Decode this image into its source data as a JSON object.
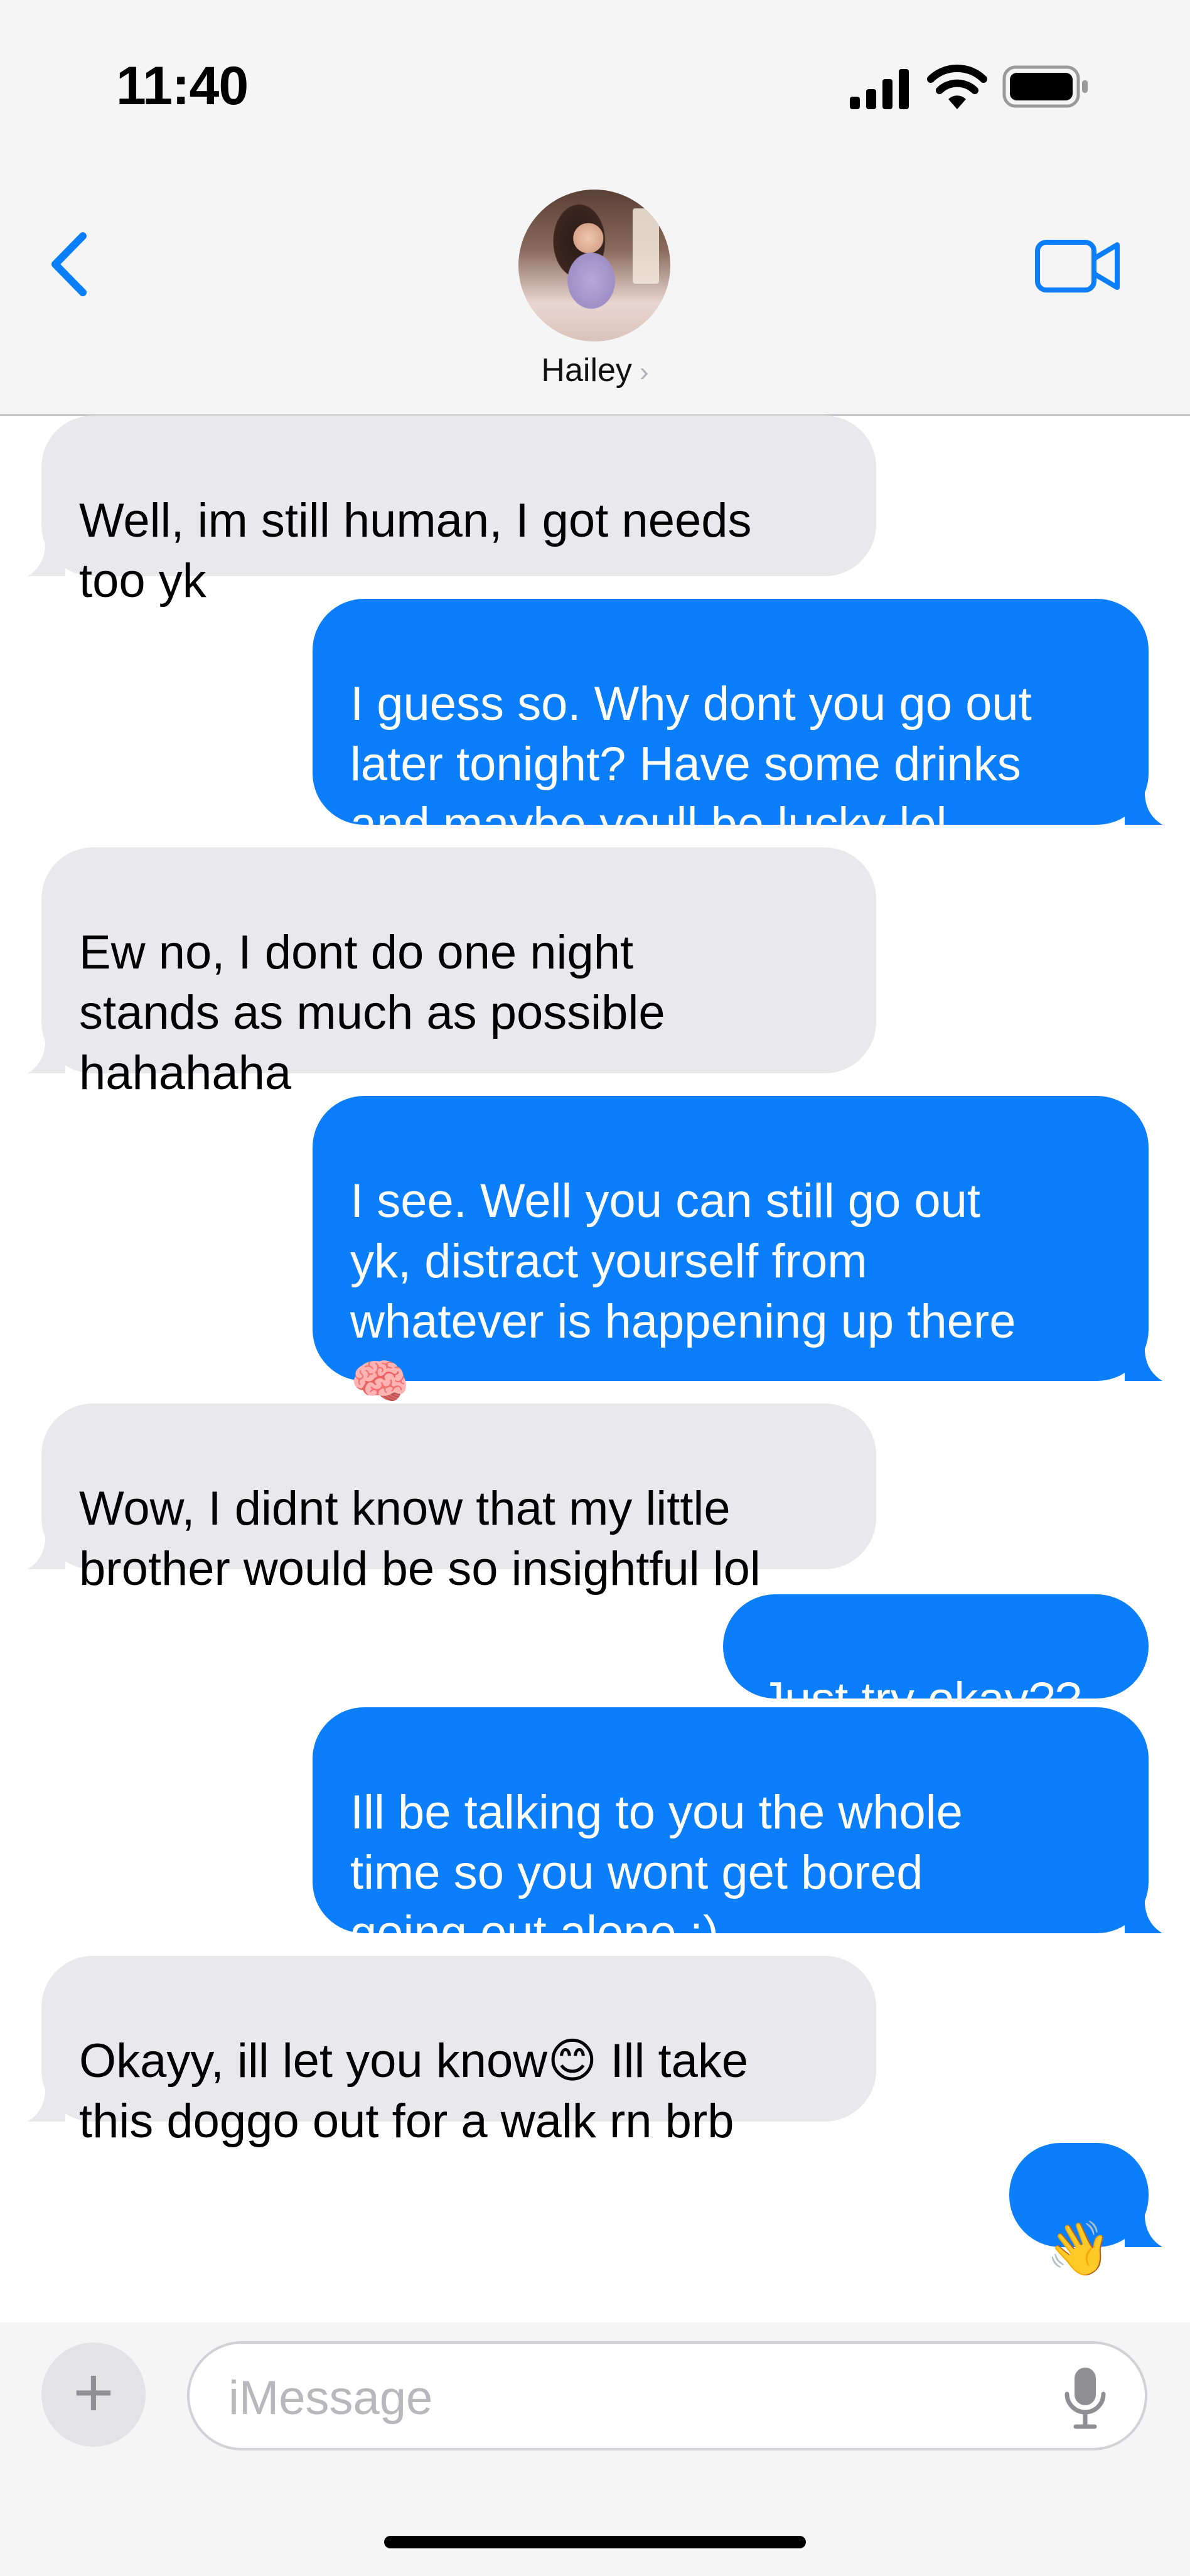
{
  "status_bar": {
    "time": "11:40"
  },
  "header": {
    "contact_name": "Hailey",
    "chevron": "›",
    "icons": [
      "back-chevron-icon",
      "video-call-icon",
      "signal-icon",
      "wifi-icon",
      "battery-icon"
    ]
  },
  "messages": [
    {
      "from": "them",
      "text": "Well, im still human, I got needs\ntoo yk"
    },
    {
      "from": "me",
      "text": "I guess so. Why dont you go out\nlater tonight? Have some drinks\nand maybe youll be lucky lol"
    },
    {
      "from": "them",
      "text": "Ew no, I dont do one night\nstands as much as possible\nhahahaha"
    },
    {
      "from": "me",
      "text": "I see. Well you can still go out\nyk, distract yourself from\nwhatever is happening up there\n🧠"
    },
    {
      "from": "them",
      "text": "Wow, I didnt know that my little\nbrother would be so insightful lol"
    },
    {
      "from": "me",
      "text": "Just try okay??"
    },
    {
      "from": "me",
      "text": "Ill be talking to you the whole\ntime so you wont get bored\ngoing out alone :)"
    },
    {
      "from": "them",
      "text": "Okayy, ill let you know😊 Ill take\nthis doggo out for a walk rn brb"
    },
    {
      "from": "me",
      "text": "👋"
    }
  ],
  "composer": {
    "plus_label": "+",
    "placeholder": "iMessage"
  },
  "colors": {
    "outgoing_bubble": "#0b7ffb",
    "incoming_bubble": "#e9e9eb",
    "accent": "#0b7ffb"
  }
}
